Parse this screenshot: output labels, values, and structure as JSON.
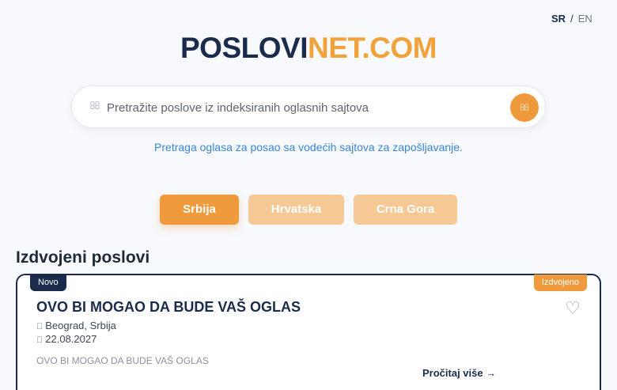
{
  "lang": {
    "active": "SR",
    "separator": "/",
    "inactive": "EN"
  },
  "logo": {
    "part1": "POSLOVI",
    "part2": "NET.COM"
  },
  "search": {
    "icon": "search-icon",
    "placeholder": "Pretražite poslove iz indeksiranih oglasnih sajtova",
    "value": "",
    "submit_icon": "search-icon"
  },
  "tagline": "Pretraga oglasa za posao sa vodećih sajtova za zapošljavanje.",
  "tabs": [
    {
      "label": "Srbija",
      "active": true
    },
    {
      "label": "Hrvatska",
      "active": false
    },
    {
      "label": "Crna Gora",
      "active": false
    }
  ],
  "featured": {
    "section_title": "Izdvojeni poslovi",
    "card": {
      "badge_new": "Novo",
      "badge_featured": "Izdvojeno",
      "title": "OVO BI MOGAO DA BUDE VAŠ OGLAS",
      "location": "Beograd, Srbija",
      "date": "22.08.2027",
      "description": "OVO BI MOGAO DA BUDE VAŠ OGLAS",
      "read_more": "Pročitaj više →",
      "favorite_icon": "heart-outline-icon"
    }
  },
  "colors": {
    "brand_dark": "#1a2b4c",
    "brand_orange": "#f09a3e",
    "tab_inactive": "#f5c896",
    "link_blue": "#3a86d4",
    "background": "#f7f9fc"
  }
}
